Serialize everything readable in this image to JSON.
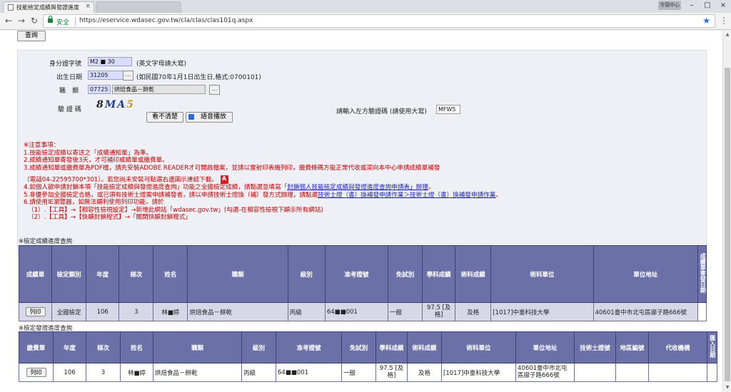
{
  "browser": {
    "tabs": [
      {
        "title": "技能檢定成績與發證進度"
      },
      {
        "title": ""
      }
    ],
    "user_badge": "冷頭中心",
    "secure_label": "安全",
    "url": "https://eservice.wdasec.gov.tw/cla/clas/clas101q.aspx"
  },
  "form": {
    "query_button": "查詢",
    "id_label": "身分證字號",
    "id_value": "M2 ■ 30",
    "id_hint": "(英文字母請大寫)",
    "birth_label": "出生日期",
    "birth_value": "31205",
    "birth_hint": "(如民國70年1月1日出生日,格式:0700101)",
    "trade_label": "職　類",
    "trade_code": "07725",
    "trade_name": "烘焙食品－餅乾",
    "browse_label": "...",
    "captcha_label": "驗 證 碼",
    "captcha_text": [
      "8",
      "M",
      "A",
      "5"
    ],
    "refresh_label": "看不清楚",
    "audio_label": "語音播放",
    "captcha_input_label": "請輸入左方驗證碼 (請使用大寫)",
    "captcha_input_value": "MFW5"
  },
  "notices": [
    "※注意事項：",
    "1.技能檢定成績以寄送之「成績通知單」為準。",
    "2.成績通知單寄發後3天，才可補印成績單或繳費單。",
    "3.成績通知單或繳費單為PDF檔，請先安裝ADOBE READER才可開啟檔案，並請以雷射印表機列印，繳費條碼方能正常代收或逕向本中心申請成績單補發",
    "（電話04-22595700*301）。若您尚未安裝可點選右邊圖示連結下載。",
    "4.如個人欲申請封鎖本項「技能檢定成績與發證進度查詢」功能之全國檢定成績，請點選並填寫「",
    "封鎖個人技能檢定成績與發證進度查詢申請表」辦理",
    "。",
    "5.非優參加全國檢定合格，或已領有技術士證需申請補發者，請以申請技術士證換（補）發方式辦理，請點選",
    "技術士證（書）換補發申請作業",
    "＞",
    "技術士證（書）換補發申請作業",
    "。",
    "6.請使用IE瀏覽器，如無法顯利使用列印功能，請於",
    "（1）.【工具】→【相容性檢視設定】→新增此網站「wdasec.gov.tw」(勾選-在相容性檢視下顯示所有網站)",
    "（2）.【工具】→【快顯封鎖程式】→「關閉快顯封鎖程式」"
  ],
  "results": {
    "title": "※檢定成績進度查詢",
    "headers": [
      "成績單",
      "檢定類別",
      "年度",
      "梯次",
      "姓名",
      "職類",
      "級別",
      "准考證號",
      "免試別",
      "學科成績",
      "術科成績",
      "術科單位",
      "單位地址",
      "成績單寄發日期"
    ],
    "rows": [
      [
        "列印",
        "全國檢定",
        "106",
        "3",
        "林■婷",
        "烘焙食品－餅乾",
        "丙級",
        "64■■001",
        "一般",
        "97.5 [及格]",
        "及格",
        "[1017]中臺科技大學",
        "40601臺中市北屯區廍子路666號",
        ""
      ]
    ]
  },
  "certificate": {
    "title": "※檢定發證進度查詢",
    "headers": [
      "繳費單",
      "年度",
      "梯次",
      "姓名",
      "職類",
      "級別",
      "准考證號",
      "免試別",
      "學科成績",
      "術科成績",
      "術科單位",
      "單位地址",
      "技術士證號",
      "地區編號",
      "代收機構",
      "匯入日期"
    ],
    "rows": [
      [
        "列印",
        "106",
        "3",
        "林■婷",
        "烘焙食品－餅乾",
        "丙級",
        "64■■001",
        "一般",
        "97.5 [及格]",
        "及格",
        "[1017]中臺科技大學",
        "40601臺中市北屯區廍子路666號",
        "",
        "",
        "",
        ""
      ]
    ]
  }
}
